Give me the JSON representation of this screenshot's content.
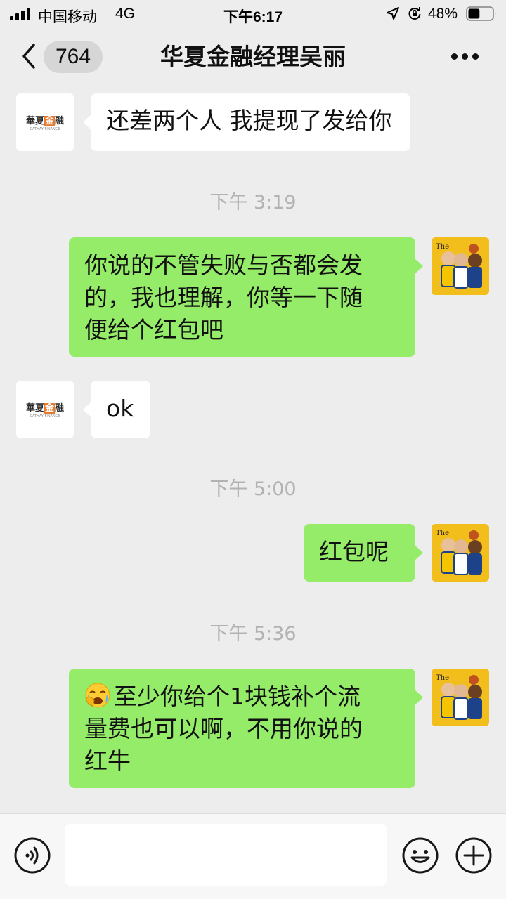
{
  "status_bar": {
    "carrier": "中国移动",
    "network": "4G",
    "time": "下午6:17",
    "battery": "48%",
    "battery_level": 0.48
  },
  "nav": {
    "unread_count": "764",
    "title": "华夏金融经理吴丽"
  },
  "contact_logo": {
    "text_a": "華夏",
    "text_b": "金",
    "text_c": "融",
    "sub": "CATHAY FINANCE"
  },
  "messages": [
    {
      "side": "left",
      "text": "还差两个人 我提现了发给你"
    },
    {
      "type": "time",
      "text": "下午 3:19"
    },
    {
      "side": "right",
      "lines": [
        "你说的不管失败与否都会发",
        "的，我也理解，你等一下随",
        "便给个红包吧"
      ]
    },
    {
      "side": "left",
      "text": "ok"
    },
    {
      "type": "time",
      "text": "下午 5:00"
    },
    {
      "side": "right",
      "text": "红包呢"
    },
    {
      "type": "time",
      "text": "下午 5:36"
    },
    {
      "side": "right",
      "emoji": "crying-face",
      "lines": [
        "至少你给个1块钱补个流",
        "量费也可以啊，不用你说的",
        "红牛"
      ]
    }
  ],
  "input": {
    "value": "",
    "placeholder": ""
  },
  "colors": {
    "background": "#ededed",
    "bubble_right": "#95ec69",
    "bubble_left": "#ffffff",
    "timestamp": "#b2b2b2"
  },
  "icons": [
    "signal-icon",
    "location-icon",
    "orientation-lock-icon",
    "battery-icon",
    "back-icon",
    "more-icon",
    "voice-icon",
    "emoji-icon",
    "plus-icon"
  ]
}
